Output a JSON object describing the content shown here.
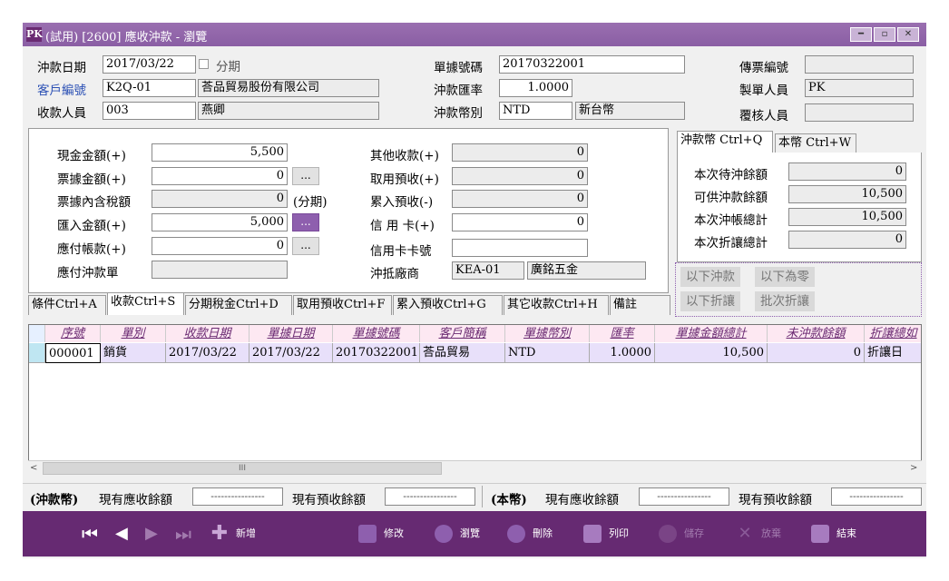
{
  "window": {
    "title": "(試用) [2600] 應收沖款 - 瀏覽",
    "icon_text": "PK",
    "buttons": [
      "minimize-icon",
      "maximize-icon",
      "close-icon"
    ]
  },
  "header": {
    "date_label": "沖款日期",
    "date_value": "2017/03/22",
    "installment_label": "分期",
    "customer_label": "客戶編號",
    "customer_code": "K2Q-01",
    "customer_name": "荅品貿易股份有限公司",
    "collector_label": "收款人員",
    "collector_code": "003",
    "collector_name": "燕卿",
    "docno_label": "單據號碼",
    "docno_value": "20170322001",
    "rate_label": "沖款匯率",
    "rate_value": "1.0000",
    "currency_label": "沖款幣別",
    "currency_code": "NTD",
    "currency_name": "新台幣",
    "voucher_label": "傳票編號",
    "voucher_value": "",
    "maker_label": "製單人員",
    "maker_value": "PK",
    "reviewer_label": "覆核人員",
    "reviewer_value": ""
  },
  "amounts_left": [
    {
      "label": "現金金額(+)",
      "value": "5,500",
      "button": "",
      "note": ""
    },
    {
      "label": "票據金額(+)",
      "value": "0",
      "button": "...",
      "note": ""
    },
    {
      "label": "票據內含稅額",
      "value": "0",
      "button": "",
      "note": "(分期)"
    },
    {
      "label": "匯入金額(+)",
      "value": "5,000",
      "button": "...",
      "note": ""
    },
    {
      "label": "應付帳款(+)",
      "value": "0",
      "button": "...",
      "note": ""
    },
    {
      "label": "應付沖款單",
      "value": "",
      "button": "",
      "note": ""
    }
  ],
  "amounts_right": [
    {
      "label": "其他收款(+)",
      "value": "0"
    },
    {
      "label": "取用預收(+)",
      "value": "0"
    },
    {
      "label": "累入預收(-)",
      "value": "0"
    },
    {
      "label": "信 用 卡(+)",
      "value": "0"
    },
    {
      "label": "信用卡卡號",
      "value": ""
    }
  ],
  "offset_vendor": {
    "label": "沖抵廠商",
    "code": "KEA-01",
    "name": "廣銘五金"
  },
  "summary_tabs": [
    "沖款幣 Ctrl+Q",
    "本幣 Ctrl+W"
  ],
  "summary": [
    {
      "label": "本次待沖餘額",
      "value": "0"
    },
    {
      "label": "可供沖款餘額",
      "value": "10,500"
    },
    {
      "label": "本次沖帳總計",
      "value": "10,500"
    },
    {
      "label": "本次折讓總計",
      "value": "0"
    }
  ],
  "action_buttons": [
    "以下沖款",
    "以下為零",
    "以下折讓",
    "批次折讓"
  ],
  "tabs": [
    "條件Ctrl+A",
    "收款Ctrl+S",
    "分期稅金Ctrl+D",
    "取用預收Ctrl+F",
    "累入預收Ctrl+G",
    "其它收款Ctrl+H",
    "備註"
  ],
  "table": {
    "columns": [
      "序號",
      "單別",
      "收款日期",
      "單據日期",
      "單據號碼",
      "客戶簡稱",
      "單據幣別",
      "匯率",
      "單據金額總計",
      "未沖款餘額",
      "折讓總如"
    ],
    "rows": [
      [
        "000001",
        "銷貨",
        "2017/03/22",
        "2017/03/22",
        "20170322001",
        "荅品貿易",
        "NTD",
        "1.0000",
        "10,500",
        "0",
        "折讓日"
      ]
    ],
    "scroll_glyph": "III"
  },
  "status": {
    "group1": "(沖款幣)",
    "ar_label": "現有應收餘額",
    "pre_label": "現有預收餘額",
    "group2": "(本幣)",
    "ar2_label": "現有應收餘額",
    "pre2_label": "現有預收餘額",
    "dash": "----------------"
  },
  "toolbar": {
    "new": "新增",
    "edit": "修改",
    "browse": "瀏覽",
    "delete": "刪除",
    "print": "列印",
    "save": "儲存",
    "discard": "放棄",
    "exit": "結束"
  }
}
